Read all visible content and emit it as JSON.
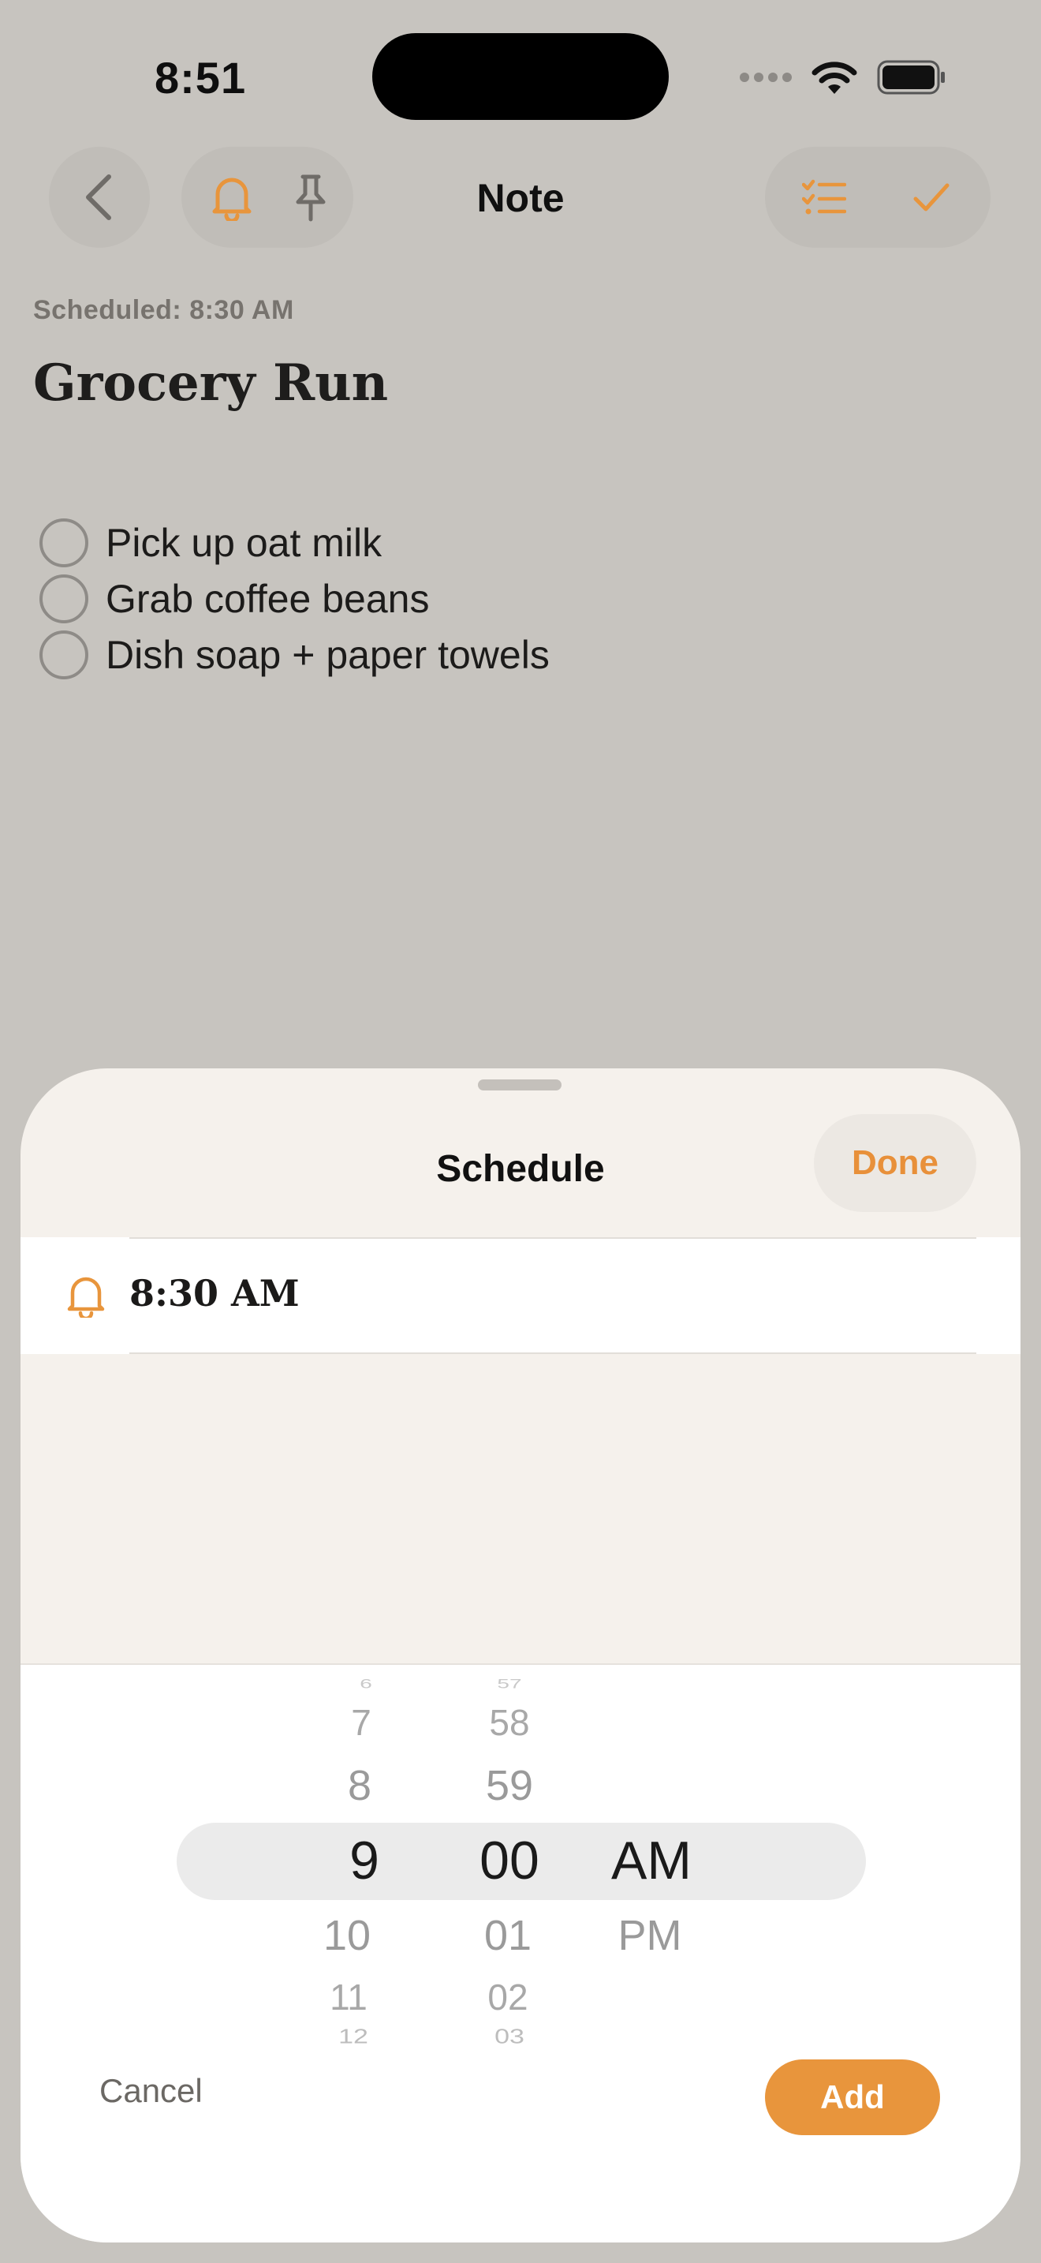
{
  "status_bar": {
    "time": "8:51"
  },
  "nav": {
    "title": "Note"
  },
  "note": {
    "scheduled_label": "Scheduled: 8:30 AM",
    "title": "Grocery Run",
    "checklist": [
      {
        "text": "Pick up oat milk",
        "checked": false
      },
      {
        "text": "Grab coffee beans",
        "checked": false
      },
      {
        "text": "Dish soap + paper towels",
        "checked": false
      }
    ]
  },
  "sheet": {
    "title": "Schedule",
    "done_label": "Done",
    "reminder_time": "8:30 AM",
    "picker": {
      "hours": {
        "far_above": "6",
        "above2": "7",
        "above1": "8",
        "selected": "9",
        "below1": "10",
        "below2": "11",
        "far_below": "12"
      },
      "minutes": {
        "far_above": "57",
        "above2": "58",
        "above1": "59",
        "selected": "00",
        "below1": "01",
        "below2": "02",
        "far_below": "03"
      },
      "period": {
        "selected": "AM",
        "below1": "PM"
      }
    },
    "cancel_label": "Cancel",
    "add_label": "Add"
  },
  "colors": {
    "accent": "#e8953c",
    "background_dim": "#c7c4bf",
    "sheet_background": "#f5f1ec"
  },
  "icons": {
    "back": "chevron-left-icon",
    "reminder": "bell-icon",
    "pin": "pin-icon",
    "checklist": "checklist-icon",
    "done": "checkmark-icon"
  }
}
